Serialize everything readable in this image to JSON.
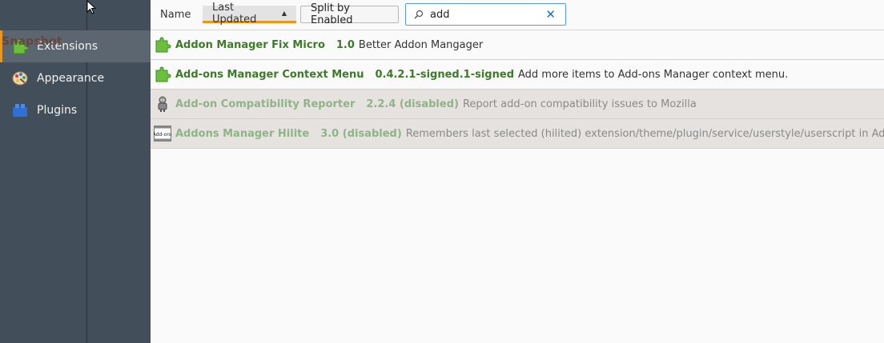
{
  "sidebar": {
    "overlay_text": "Snapshot",
    "categories": [
      {
        "label": "Extensions",
        "icon": "puzzle-icon",
        "selected": true
      },
      {
        "label": "Appearance",
        "icon": "palette-icon",
        "selected": false
      },
      {
        "label": "Plugins",
        "icon": "lego-brick-icon",
        "selected": false
      }
    ]
  },
  "toolbar": {
    "sort_name_label": "Name",
    "sort_updated_label": "Last Updated",
    "sort_updated_arrow": "▲",
    "split_button_label": "Split by Enabled",
    "search": {
      "value": "add",
      "clear_glyph": "✕"
    }
  },
  "addons": [
    {
      "name": "Addon Manager Fix Micro",
      "version": "1.0",
      "description": "Better Addon Mangager",
      "icon": "puzzle-piece-icon",
      "state": "enabled"
    },
    {
      "name": "Add-ons Manager Context Menu",
      "version": "0.4.2.1-signed.1-signed",
      "description": "Add more items to Add-ons Manager context menu.",
      "icon": "puzzle-piece-icon",
      "state": "enabled"
    },
    {
      "name": "Add-on Compatibility Reporter",
      "version": "2.2.4 (disabled)",
      "description": "Report add-on compatibility issues to Mozilla",
      "icon": "robot-icon",
      "state": "disabled"
    },
    {
      "name": "Addons Manager Hilite",
      "version": "3.0 (disabled)",
      "description": "Remembers last selected (hilited) extension/theme/plugin/service/userstyle/userscript in Add-ons Manager",
      "icon": "addons-badge-icon",
      "icon_text": "Add-ons",
      "state": "disabled"
    }
  ],
  "colors": {
    "sidebar_bg": "#424f5a",
    "accent": "#e8961c",
    "enabled_name": "#3d7a2a",
    "disabled_row_bg": "#e5e2df",
    "search_border": "#5a9ad5"
  }
}
